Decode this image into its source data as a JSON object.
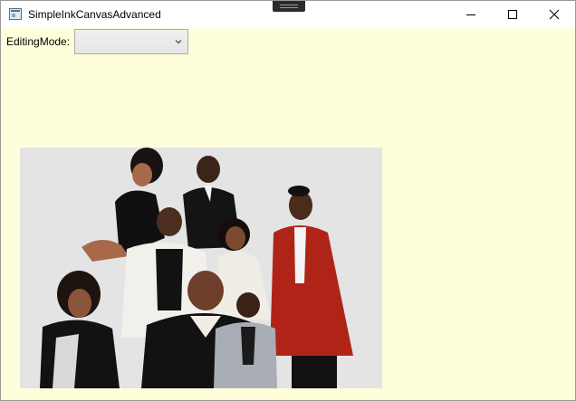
{
  "window": {
    "title": "SimpleInkCanvasAdvanced",
    "controls": [
      "minimize-icon",
      "maximize-icon",
      "close-icon"
    ]
  },
  "toolbar": {
    "editing_mode_label": "EditingMode:",
    "editing_mode_value": ""
  },
  "canvas": {
    "background_color": "#fffedb",
    "image_description_icon": "family-photo"
  },
  "colors": {
    "accent": "#fffedb",
    "titlebar": "#ffffff"
  }
}
